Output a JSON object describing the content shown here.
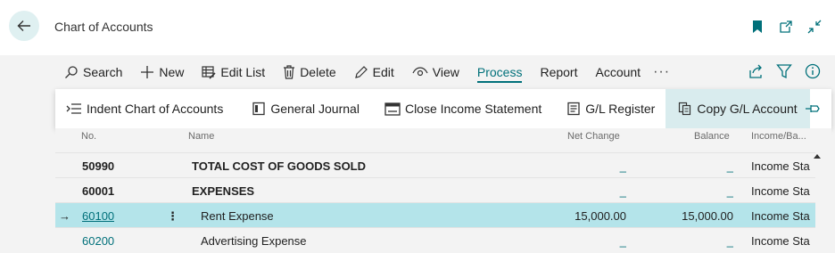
{
  "header": {
    "title": "Chart of Accounts"
  },
  "actions": [
    {
      "label": "Search",
      "icon": "search-icon"
    },
    {
      "label": "New",
      "icon": "plus-icon"
    },
    {
      "label": "Edit List",
      "icon": "edit-list-icon"
    },
    {
      "label": "Delete",
      "icon": "trash-icon"
    },
    {
      "label": "Edit",
      "icon": "pencil-icon"
    },
    {
      "label": "View",
      "icon": "eye-icon"
    },
    {
      "label": "Process",
      "active": true
    },
    {
      "label": "Report"
    },
    {
      "label": "Account"
    }
  ],
  "more_label": "···",
  "flyout": [
    {
      "label": "Indent Chart of Accounts",
      "icon": "indent-icon"
    },
    {
      "label": "General Journal",
      "icon": "journal-icon"
    },
    {
      "label": "Close Income Statement",
      "icon": "calendar-icon"
    },
    {
      "label": "G/L Register",
      "icon": "register-icon"
    },
    {
      "label": "Copy G/L Account",
      "icon": "copy-icon"
    }
  ],
  "grid": {
    "columns": {
      "no": "No.",
      "name": "Name",
      "net_change": "Net Change",
      "balance": "Balance",
      "income_balance": "Income/Ba..."
    },
    "rows": [
      {
        "no": "50990",
        "name": "TOTAL COST OF GOODS SOLD",
        "net_change": "_",
        "balance": "_",
        "income_balance": "Income Sta"
      },
      {
        "no": "60001",
        "name": "EXPENSES",
        "net_change": "_",
        "balance": "_",
        "income_balance": "Income Sta"
      },
      {
        "no": "60100",
        "name": "Rent Expense",
        "net_change": "15,000.00",
        "balance": "15,000.00",
        "income_balance": "Income Sta",
        "row_marker": "→",
        "row_menu": "⋮"
      },
      {
        "no": "60200",
        "name": "Advertising Expense",
        "net_change": "_",
        "balance": "_",
        "income_balance": "Income Sta"
      }
    ]
  },
  "colors": {
    "accent": "#00707a",
    "selected_row": "#b4e4ea",
    "hover": "#d9ecee"
  }
}
